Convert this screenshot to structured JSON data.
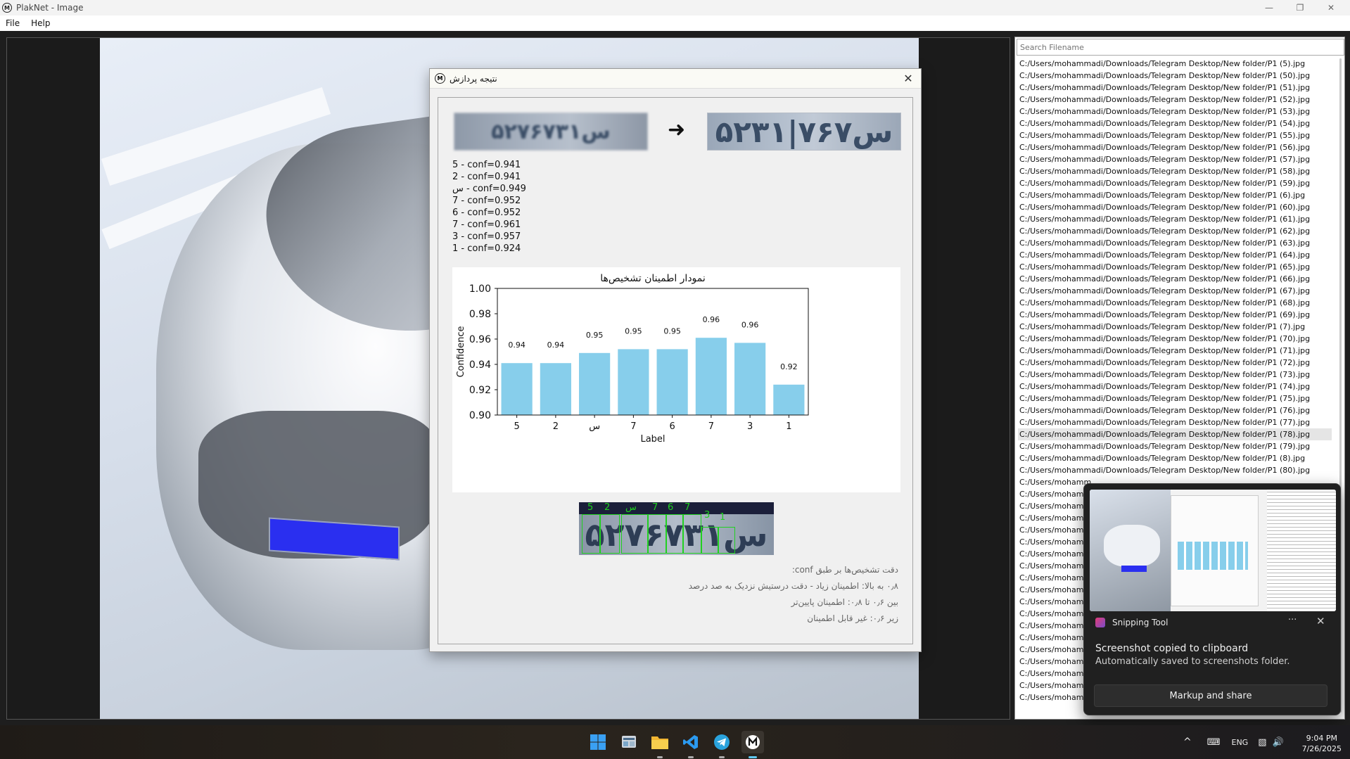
{
  "window": {
    "title": "PlakNet - Image",
    "logo": "M"
  },
  "menu": [
    "File",
    "Help"
  ],
  "dialog": {
    "title": "نتیجه پردازش",
    "close": "✕",
    "arrow": "➜",
    "plate_input_text": "۵۲س۷۶۷۳۱",
    "plate_output_text": "۵۲س۷۶۷|۳۱",
    "detections": [
      "5 - conf=0.941",
      "2 - conf=0.941",
      "س - conf=0.949",
      "7 - conf=0.952",
      "6 - conf=0.952",
      "7 - conf=0.961",
      "3 - conf=0.957",
      "1 - conf=0.924"
    ],
    "segment_labels": [
      "5",
      "2",
      "س",
      "7",
      "6",
      "7",
      "3",
      "1"
    ],
    "segment_plate_text": "۵۲س۷۶۷۳۱",
    "notes": [
      "دقت تشخیص‌ها بر طبق conf:",
      "۰٫۸ به بالا: اطمینان زیاد - دقت درستیش نزدیک به صد درصد",
      "بین ۰٫۶ تا ۰٫۸: اطمینان پایین‌تر",
      "زیر ۰٫۶: غیر قابل اطمینان"
    ]
  },
  "chart_data": {
    "type": "bar",
    "title": "نمودار اطمینان تشخیص‌ها",
    "xlabel": "Label",
    "ylabel": "Confidence",
    "categories": [
      "5",
      "2",
      "س",
      "7",
      "6",
      "7",
      "3",
      "1"
    ],
    "values": [
      0.941,
      0.941,
      0.949,
      0.952,
      0.952,
      0.961,
      0.957,
      0.924
    ],
    "value_labels": [
      "0.94",
      "0.94",
      "0.95",
      "0.95",
      "0.95",
      "0.96",
      "0.96",
      "0.92"
    ],
    "ylim": [
      0.9,
      1.0
    ],
    "yticks": [
      "0.90",
      "0.92",
      "0.94",
      "0.96",
      "0.98",
      "1.00"
    ],
    "bar_color": "#87ceeb",
    "grid": false
  },
  "file_panel": {
    "search_placeholder": "Search Filename",
    "files": [
      "C:/Users/mohammadi/Downloads/Telegram Desktop/New folder/P1 (5).jpg",
      "C:/Users/mohammadi/Downloads/Telegram Desktop/New folder/P1 (50).jpg",
      "C:/Users/mohammadi/Downloads/Telegram Desktop/New folder/P1 (51).jpg",
      "C:/Users/mohammadi/Downloads/Telegram Desktop/New folder/P1 (52).jpg",
      "C:/Users/mohammadi/Downloads/Telegram Desktop/New folder/P1 (53).jpg",
      "C:/Users/mohammadi/Downloads/Telegram Desktop/New folder/P1 (54).jpg",
      "C:/Users/mohammadi/Downloads/Telegram Desktop/New folder/P1 (55).jpg",
      "C:/Users/mohammadi/Downloads/Telegram Desktop/New folder/P1 (56).jpg",
      "C:/Users/mohammadi/Downloads/Telegram Desktop/New folder/P1 (57).jpg",
      "C:/Users/mohammadi/Downloads/Telegram Desktop/New folder/P1 (58).jpg",
      "C:/Users/mohammadi/Downloads/Telegram Desktop/New folder/P1 (59).jpg",
      "C:/Users/mohammadi/Downloads/Telegram Desktop/New folder/P1 (6).jpg",
      "C:/Users/mohammadi/Downloads/Telegram Desktop/New folder/P1 (60).jpg",
      "C:/Users/mohammadi/Downloads/Telegram Desktop/New folder/P1 (61).jpg",
      "C:/Users/mohammadi/Downloads/Telegram Desktop/New folder/P1 (62).jpg",
      "C:/Users/mohammadi/Downloads/Telegram Desktop/New folder/P1 (63).jpg",
      "C:/Users/mohammadi/Downloads/Telegram Desktop/New folder/P1 (64).jpg",
      "C:/Users/mohammadi/Downloads/Telegram Desktop/New folder/P1 (65).jpg",
      "C:/Users/mohammadi/Downloads/Telegram Desktop/New folder/P1 (66).jpg",
      "C:/Users/mohammadi/Downloads/Telegram Desktop/New folder/P1 (67).jpg",
      "C:/Users/mohammadi/Downloads/Telegram Desktop/New folder/P1 (68).jpg",
      "C:/Users/mohammadi/Downloads/Telegram Desktop/New folder/P1 (69).jpg",
      "C:/Users/mohammadi/Downloads/Telegram Desktop/New folder/P1 (7).jpg",
      "C:/Users/mohammadi/Downloads/Telegram Desktop/New folder/P1 (70).jpg",
      "C:/Users/mohammadi/Downloads/Telegram Desktop/New folder/P1 (71).jpg",
      "C:/Users/mohammadi/Downloads/Telegram Desktop/New folder/P1 (72).jpg",
      "C:/Users/mohammadi/Downloads/Telegram Desktop/New folder/P1 (73).jpg",
      "C:/Users/mohammadi/Downloads/Telegram Desktop/New folder/P1 (74).jpg",
      "C:/Users/mohammadi/Downloads/Telegram Desktop/New folder/P1 (75).jpg",
      "C:/Users/mohammadi/Downloads/Telegram Desktop/New folder/P1 (76).jpg",
      "C:/Users/mohammadi/Downloads/Telegram Desktop/New folder/P1 (77).jpg",
      "C:/Users/mohammadi/Downloads/Telegram Desktop/New folder/P1 (78).jpg",
      "C:/Users/mohammadi/Downloads/Telegram Desktop/New folder/P1 (79).jpg",
      "C:/Users/mohammadi/Downloads/Telegram Desktop/New folder/P1 (8).jpg",
      "C:/Users/mohammadi/Downloads/Telegram Desktop/New folder/P1 (80).jpg",
      "C:/Users/mohamm",
      "C:/Users/mohamm",
      "C:/Users/mohamm",
      "C:/Users/mohamm",
      "C:/Users/mohamm",
      "C:/Users/mohamm",
      "C:/Users/mohamm",
      "C:/Users/mohamm",
      "C:/Users/mohamm",
      "C:/Users/mohamm",
      "C:/Users/mohamm",
      "C:/Users/mohamm",
      "C:/Users/mohamm",
      "C:/Users/mohamm",
      "C:/Users/mohamm",
      "C:/Users/mohamm",
      "C:/Users/mohamm",
      "C:/Users/mohamm",
      "C:/Users/mohamm"
    ],
    "selected_index": 31
  },
  "toast": {
    "app": "Snipping Tool",
    "more": "···",
    "close": "✕",
    "message": "Screenshot copied to clipboard",
    "sub": "Automatically saved to screenshots folder.",
    "button": "Markup and share"
  },
  "taskbar": {
    "tray_caret": "^",
    "language": "ENG",
    "time": "9:04 PM",
    "date": "7/26/2025",
    "icons": [
      "windows-start-icon",
      "widgets-icon",
      "file-explorer-icon",
      "vscode-icon",
      "telegram-icon",
      "plaknet-icon"
    ]
  }
}
